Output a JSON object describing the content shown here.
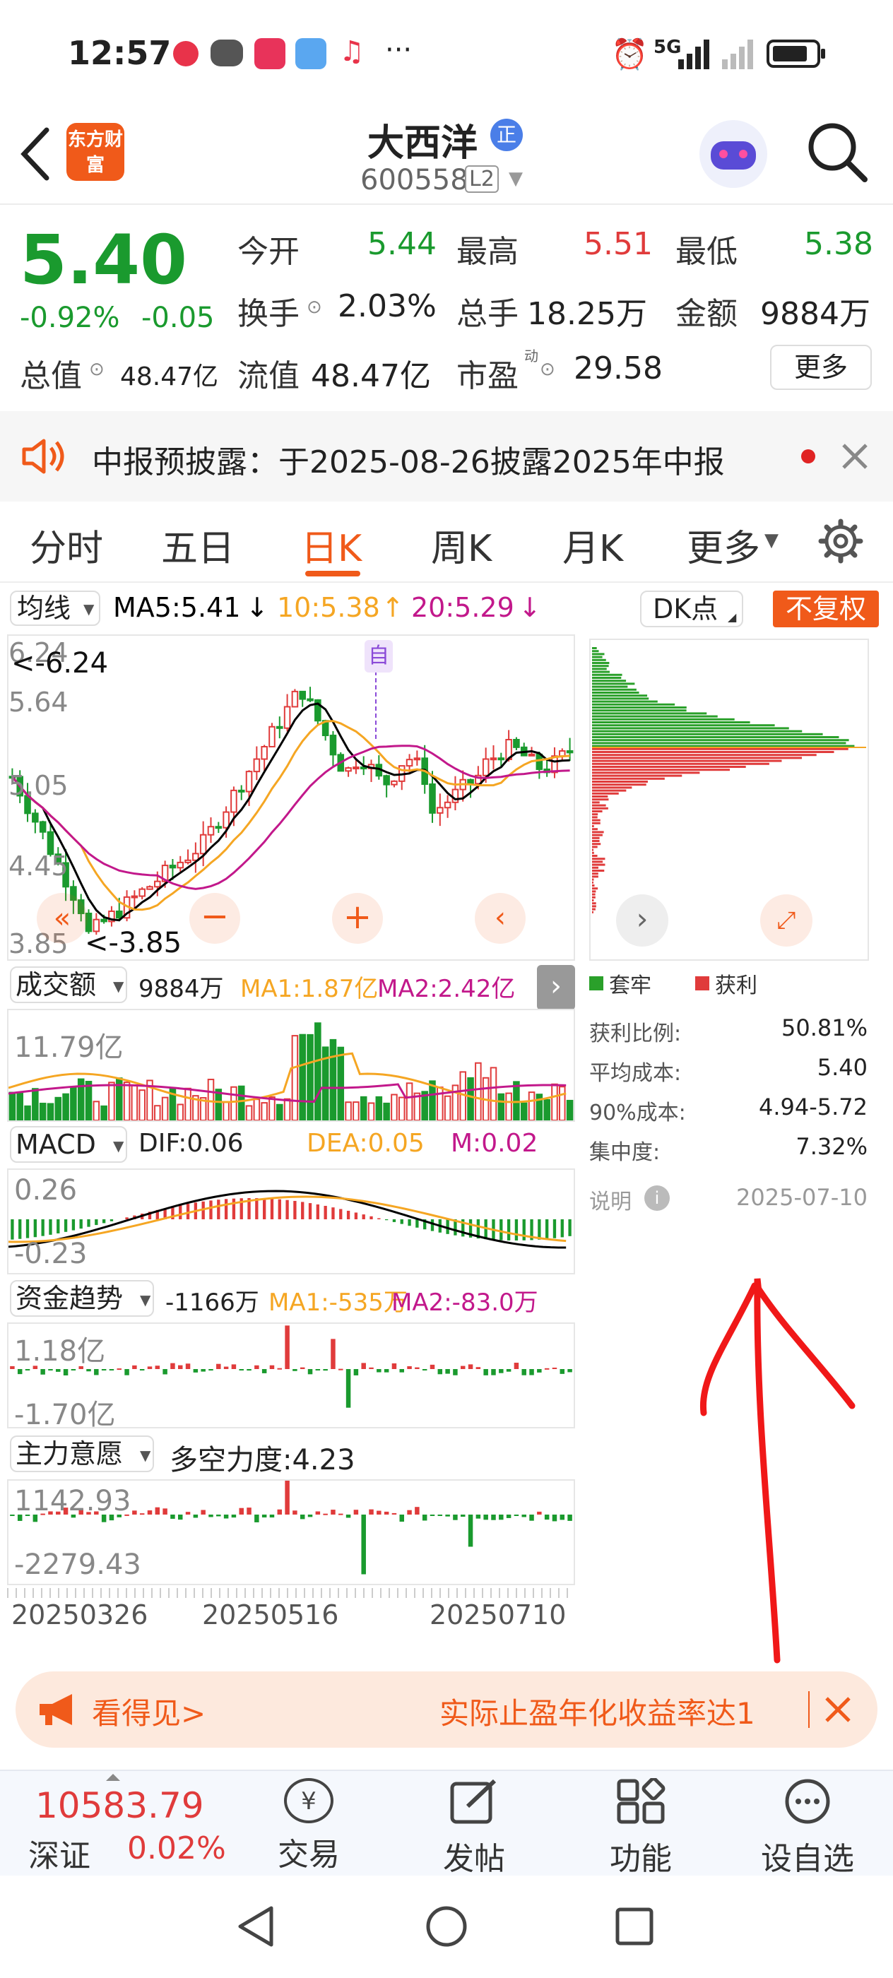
{
  "status_bar": {
    "time": "12:57",
    "signal": "5G",
    "more": "···"
  },
  "header": {
    "title": "大西洋",
    "title_badge": "正",
    "code": "600558",
    "level": "L2",
    "app_logo": "东方财富"
  },
  "quote": {
    "price": "5.40",
    "change_pct": "-0.92%",
    "change": "-0.05",
    "open_label": "今开",
    "open": "5.44",
    "high_label": "最高",
    "high": "5.51",
    "low_label": "最低",
    "low": "5.38",
    "turnover_label": "换手",
    "turnover": "2.03%",
    "volume_label": "总手",
    "volume": "18.25万",
    "amount_label": "金额",
    "amount": "9884万",
    "mktcap_label": "总值",
    "mktcap": "48.47亿",
    "float_label": "流值",
    "float_cap": "48.47亿",
    "pe_label": "市盈",
    "pe_sup": "动",
    "pe": "29.58",
    "more_btn": "更多"
  },
  "notice": {
    "text": "中报预披露：于2025-08-26披露2025年中报"
  },
  "tabs": [
    "分时",
    "五日",
    "日K",
    "周K",
    "月K",
    "更多"
  ],
  "tabs_active": "日K",
  "ma_bar": {
    "selector": "均线",
    "ma5": "MA5:5.41",
    "ma10": "10:5.38",
    "ma20": "20:5.29",
    "dk": "DK点",
    "fq": "不复权"
  },
  "kline": {
    "y_ticks": [
      "6.24",
      "5.64",
      "5.05",
      "4.45",
      "3.85"
    ],
    "max_label": "<-6.24",
    "min_label": "<-3.85",
    "marker": "自"
  },
  "volume_panel": {
    "selector": "成交额",
    "value": "9884万",
    "ma1": "MA1:1.87亿",
    "ma2": "MA2:2.42亿",
    "max": "11.79亿"
  },
  "macd_panel": {
    "selector": "MACD",
    "dif": "DIF:0.06",
    "dea": "DEA:0.05",
    "m": "M:0.02",
    "top": "0.26",
    "bottom": "-0.23"
  },
  "fund_panel": {
    "selector": "资金趋势",
    "value": "-1166万",
    "ma1": "MA1:-535万",
    "ma2": "MA2:-83.0万",
    "top": "1.18亿",
    "bottom": "-1.70亿"
  },
  "main_panel": {
    "selector": "主力意愿",
    "label": "多空力度:4.23",
    "top": "1142.93",
    "bottom": "-2279.43"
  },
  "x_dates": [
    "20250326",
    "20250516",
    "20250710"
  ],
  "chip": {
    "legend_trapped": "套牢",
    "legend_profit": "获利",
    "rows": [
      {
        "label": "获利比例:",
        "value": "50.81%"
      },
      {
        "label": "平均成本:",
        "value": "5.40"
      },
      {
        "label": "90%成本:",
        "value": "4.94-5.72"
      },
      {
        "label": "集中度:",
        "value": "7.32%"
      }
    ],
    "note_label": "说明",
    "date": "2025-07-10"
  },
  "ad": {
    "left": "看得见>",
    "right": "实际止盈年化收益率达1"
  },
  "index": {
    "value": "10583.79",
    "name": "深证",
    "pct": "0.02%"
  },
  "bottom_nav": [
    "交易",
    "发帖",
    "功能",
    "设自选"
  ],
  "colors": {
    "up": "#e03b3b",
    "down": "#1a9a2e",
    "accent": "#f05a1a",
    "ma5": "#000000",
    "ma10": "#f5a623",
    "ma20": "#c2188b"
  }
}
